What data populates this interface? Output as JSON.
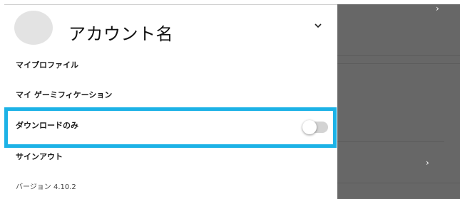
{
  "account": {
    "name": "アカウント名"
  },
  "menu": {
    "my_profile": "マイプロファイル",
    "gamification": "マイ ゲーミフィケーション",
    "download_only": "ダウンロードのみ",
    "sign_out": "サインアウト"
  },
  "download_only_toggle": {
    "on": false
  },
  "version": "バージョン 4.10.2",
  "icons": {
    "expand": "chevron-down-icon",
    "background_rows": "chevron-right-icon"
  },
  "colors": {
    "highlight": "#1cb2e6",
    "overlay": "#676767",
    "toggle_track": "#d3d3d3"
  }
}
